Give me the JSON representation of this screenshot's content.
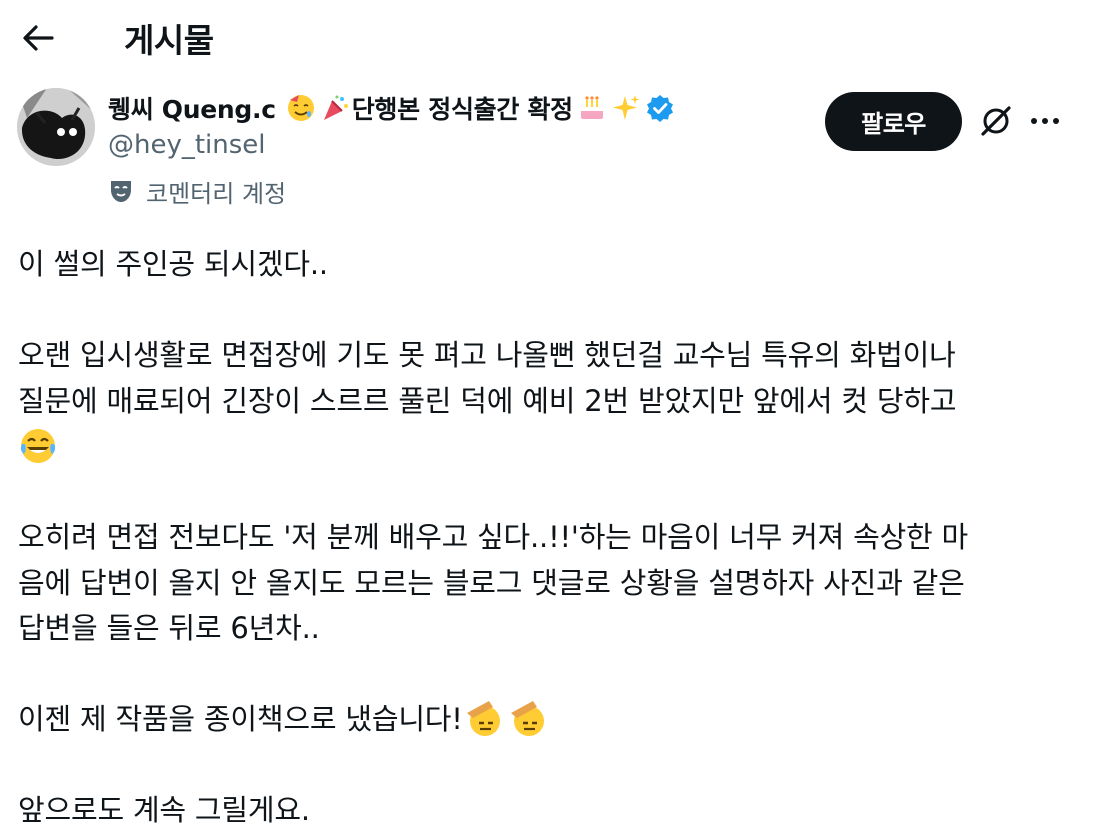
{
  "header": {
    "title": "게시물"
  },
  "author": {
    "name": "퀭씨 Queng.c",
    "bio_badge": "단행본 정식출간 확정",
    "handle": "@hey_tinsel",
    "label": "코멘터리 계정",
    "verified": true
  },
  "actions": {
    "follow_label": "팔로우"
  },
  "post": {
    "p1": "이 썰의 주인공 되시겠다..",
    "p2_line1": "오랜 입시생활로 면접장에 기도 못 펴고 나올뻔 했던걸 교수님 특유의 화법이나",
    "p2_line2": "질문에 매료되어 긴장이 스르르 풀린 덕에 예비 2번 받았지만 앞에서 컷 당하고",
    "p3_line1": "오히려 면접 전보다도 '저 분께 배우고 싶다..!!'하는 마음이 너무 커져 속상한 마",
    "p3_line2": "음에 답변이 올지 안 올지도 모르는 블로그 댓글로 상황을 설명하자 사진과 같은",
    "p3_line3": "답변을 들은 뒤로 6년차..",
    "p4": "이젠 제 작품을 종이책으로 냈습니다!",
    "p5": "앞으로도 계속 그릴게요."
  },
  "icons": {
    "back": "arrow-left-icon",
    "grok": "grok-icon",
    "more": "more-horizontal-icon",
    "verified": "verified-badge-icon",
    "commentary": "mask-icon"
  },
  "colors": {
    "text": "#0f1419",
    "secondary": "#536471",
    "verified": "#1d9bf0",
    "button": "#0f1419"
  }
}
